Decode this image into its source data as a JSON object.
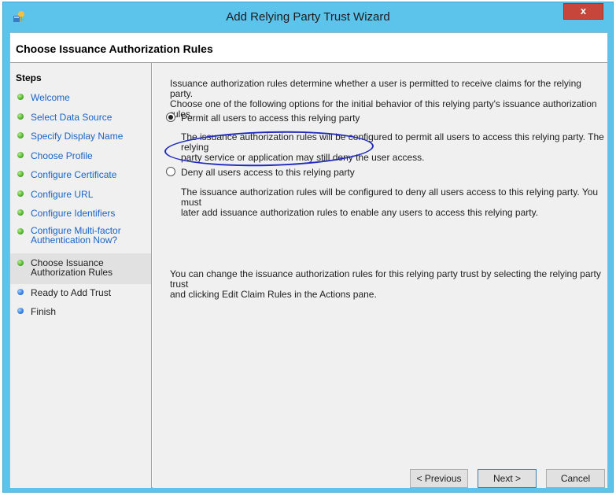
{
  "window": {
    "title": "Add Relying Party Trust Wizard",
    "close_glyph": "x",
    "app_icon": "server-trust-icon"
  },
  "page": {
    "title": "Choose Issuance Authorization Rules"
  },
  "steps": {
    "title": "Steps",
    "items": [
      {
        "label_lines": [
          "Welcome"
        ],
        "state": "done"
      },
      {
        "label_lines": [
          "Select Data Source"
        ],
        "state": "done"
      },
      {
        "label_lines": [
          "Specify Display Name"
        ],
        "state": "done"
      },
      {
        "label_lines": [
          "Choose Profile"
        ],
        "state": "done"
      },
      {
        "label_lines": [
          "Configure Certificate"
        ],
        "state": "done"
      },
      {
        "label_lines": [
          "Configure URL"
        ],
        "state": "done"
      },
      {
        "label_lines": [
          "Configure Identifiers"
        ],
        "state": "done"
      },
      {
        "label_lines": [
          "Configure Multi-factor",
          "Authentication Now?"
        ],
        "state": "done"
      },
      {
        "label_lines": [
          "Choose Issuance",
          "Authorization Rules"
        ],
        "state": "current"
      },
      {
        "label_lines": [
          "Ready to Add Trust"
        ],
        "state": "todo"
      },
      {
        "label_lines": [
          "Finish"
        ],
        "state": "todo"
      }
    ]
  },
  "content": {
    "intro_lines": [
      "Issuance authorization rules determine whether a user is permitted to receive claims for the relying party.",
      "Choose one of the following options for the initial behavior of this relying party's issuance authorization rules."
    ],
    "options": [
      {
        "label": "Permit all users to access this relying party",
        "selected": true,
        "desc_lines": [
          "The issuance authorization rules will be configured to permit all users to access this relying party. The relying",
          "party service or application may still deny the user access."
        ]
      },
      {
        "label": "Deny all users access to this relying party",
        "selected": false,
        "desc_lines": [
          "The issuance authorization rules will be configured to deny all users access to this relying party. You must",
          "later add issuance authorization rules to enable any users to access this relying party."
        ]
      }
    ],
    "hint_lines": [
      "You can change the issuance authorization rules for this relying party trust by selecting the relying party trust",
      "and clicking Edit Claim Rules in the Actions pane."
    ]
  },
  "buttons": {
    "previous": "< Previous",
    "next": "Next >",
    "cancel": "Cancel"
  },
  "colors": {
    "title_bar": "#5cc3ea",
    "link_blue": "#1964c8",
    "annotation_ellipse": "#1f2bbd",
    "close_red": "#c7463c"
  }
}
